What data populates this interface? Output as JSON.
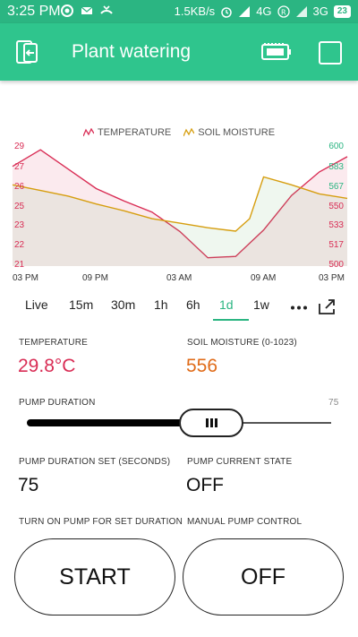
{
  "status_bar": {
    "time": "3:25 PM",
    "network_speed": "1.5KB/s",
    "net1": "4G",
    "net2": "3G",
    "battery": "23"
  },
  "header": {
    "title": "Plant watering"
  },
  "chart_data": {
    "type": "line",
    "title": "",
    "legend": [
      "TEMPERATURE",
      "SOIL MOISTURE"
    ],
    "x_ticks": [
      "03 PM",
      "09 PM",
      "03 AM",
      "09 AM",
      "03 PM"
    ],
    "y_left_ticks": [
      "29",
      "27",
      "26",
      "25",
      "23",
      "22",
      "21"
    ],
    "y_right_ticks": [
      "600",
      "583",
      "567",
      "550",
      "533",
      "517",
      "500"
    ],
    "series": [
      {
        "name": "TEMPERATURE",
        "color": "#d92d55",
        "x": [
          "03 PM",
          "05 PM",
          "07 PM",
          "09 PM",
          "11 PM",
          "01 AM",
          "03 AM",
          "05 AM",
          "07 AM",
          "09 AM",
          "11 AM",
          "01 PM",
          "03 PM"
        ],
        "values": [
          27.8,
          29.0,
          27.6,
          26.2,
          25.3,
          24.5,
          23.1,
          21.2,
          21.3,
          23.2,
          25.7,
          27.4,
          28.5
        ]
      },
      {
        "name": "SOIL MOISTURE",
        "color": "#d69e0f",
        "x": [
          "03 PM",
          "05 PM",
          "07 PM",
          "09 PM",
          "11 PM",
          "01 AM",
          "03 AM",
          "05 AM",
          "07 AM",
          "08 AM",
          "09 AM",
          "11 AM",
          "01 PM",
          "03 PM"
        ],
        "values": [
          568,
          563,
          558,
          551,
          545,
          538,
          534,
          530,
          527,
          538,
          575,
          568,
          560,
          556
        ]
      }
    ]
  },
  "range_tabs": [
    "Live",
    "15m",
    "30m",
    "1h",
    "6h",
    "1d",
    "1w"
  ],
  "range_active": "1d",
  "widgets": {
    "temperature_label": "TEMPERATURE",
    "temperature_value": "29.8°C",
    "soil_label": "SOIL MOISTURE (0-1023)",
    "soil_value": "556",
    "pump_duration_label": "PUMP DURATION",
    "pump_duration_value": "75",
    "pump_duration_slider_fraction": 0.64,
    "pump_duration_set_label": "PUMP DURATION SET (SECONDS)",
    "pump_duration_set_value": "75",
    "pump_state_label": "PUMP CURRENT STATE",
    "pump_state_value": "OFF",
    "turn_on_label": "TURN ON PUMP FOR SET DURATION",
    "manual_label": "MANUAL PUMP CONTROL",
    "start_button": "START",
    "off_button": "OFF"
  },
  "colors": {
    "accent": "#2fc58d",
    "temperature": "#d92d55",
    "soil": "#e06c1a"
  }
}
